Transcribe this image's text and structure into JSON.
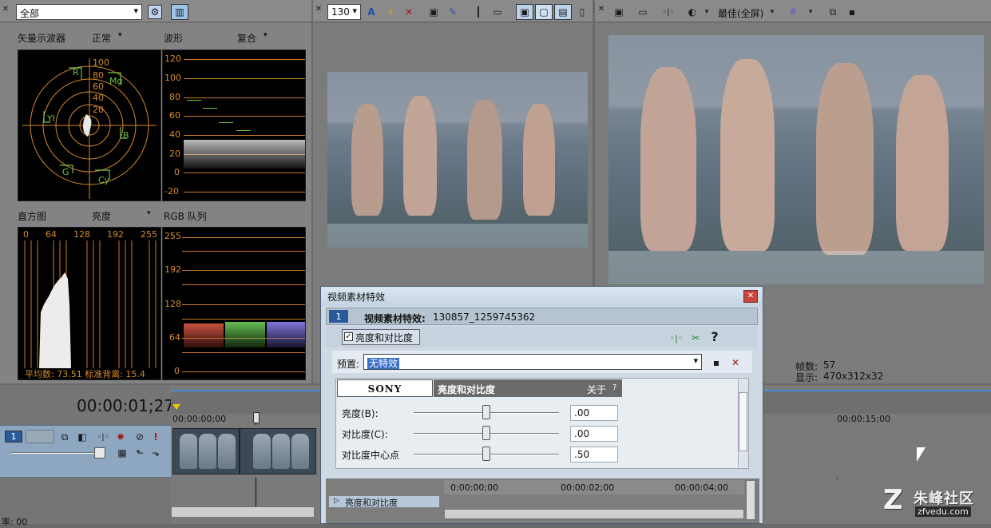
{
  "scopes": {
    "dropdown_value": "全部",
    "vectorscope": {
      "label": "矢量示波器",
      "mode": "正常",
      "rings": [
        "100",
        "80",
        "60",
        "40",
        "20"
      ],
      "targets": [
        "R",
        "Mg",
        "YI",
        "B",
        "G",
        "Cy"
      ]
    },
    "waveform": {
      "label": "波形",
      "mode": "复合",
      "ticks": [
        "120",
        "100",
        "80",
        "60",
        "40",
        "20",
        "0",
        "-20"
      ]
    },
    "histogram": {
      "label": "直方图",
      "mode": "亮度",
      "ticks": [
        "0",
        "64",
        "128",
        "192",
        "255"
      ],
      "stats": "平均数: 73.51 标准背离: 15.4"
    },
    "rgb_parade": {
      "label": "RGB 队列",
      "ticks": [
        "255",
        "192",
        "128",
        "64",
        "0"
      ]
    }
  },
  "preview_toolbar": {
    "quality_value": "130"
  },
  "main_preview": {
    "quality_label": "最佳(全屏)",
    "frames_label": "帧数:",
    "frames_value": "57",
    "display_label": "显示:",
    "display_value": "470x312x32"
  },
  "timeline": {
    "timecode": "00:00:01;27",
    "ruler_start": "00:00:00;00",
    "ruler_15": "00:00:15;00",
    "track_number": "1",
    "status_left": "率: 00"
  },
  "dialog": {
    "title": "视频素材特效",
    "chain_index": "1",
    "chain_label": "视频素材特效:",
    "chain_value": "130857_1259745362",
    "plugin_name": "亮度和对比度",
    "preset_label": "预置:",
    "preset_value": "无特效",
    "brand": "SONY",
    "panel_title": "亮度和对比度",
    "about": "关于",
    "about_q": "?",
    "params": [
      {
        "label": "亮度(B):",
        "value": ".00",
        "pos": 0.5
      },
      {
        "label": "对比度(C):",
        "value": ".00",
        "pos": 0.5
      },
      {
        "label": "对比度中心点",
        "value": ".50",
        "pos": 0.5
      }
    ],
    "kf_ruler": [
      "0:00:00;00",
      "00:00:02;00",
      "00:00:04;00"
    ],
    "kf_track": "亮度和对比度"
  },
  "watermark": {
    "main": "朱峰社区",
    "sub": "zfvedu.com"
  }
}
